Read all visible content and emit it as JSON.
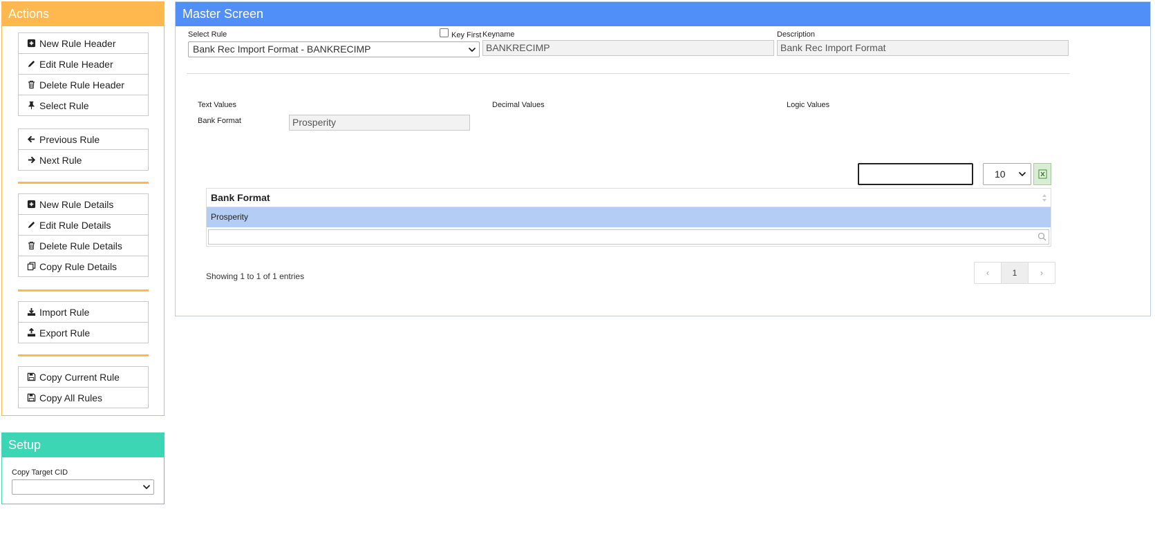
{
  "actions": {
    "title": "Actions",
    "groups": [
      [
        {
          "label": "New Rule Header",
          "icon": "plus-square-icon"
        },
        {
          "label": "Edit Rule Header",
          "icon": "pencil-icon"
        },
        {
          "label": "Delete Rule Header",
          "icon": "trash-icon"
        },
        {
          "label": "Select Rule",
          "icon": "pushpin-icon"
        }
      ],
      [
        {
          "label": "Previous Rule",
          "icon": "arrow-left-icon"
        },
        {
          "label": "Next Rule",
          "icon": "arrow-right-icon"
        }
      ],
      [
        {
          "label": "New Rule Details",
          "icon": "plus-square-icon"
        },
        {
          "label": "Edit Rule Details",
          "icon": "pencil-icon"
        },
        {
          "label": "Delete Rule Details",
          "icon": "trash-icon"
        },
        {
          "label": "Copy Rule Details",
          "icon": "copy-icon"
        }
      ],
      [
        {
          "label": "Import Rule",
          "icon": "download-icon"
        },
        {
          "label": "Export Rule",
          "icon": "upload-icon"
        }
      ],
      [
        {
          "label": "Copy Current Rule",
          "icon": "floppy-disk-icon"
        },
        {
          "label": "Copy All Rules",
          "icon": "floppy-disk-icon"
        }
      ]
    ]
  },
  "setup": {
    "title": "Setup",
    "copy_target_label": "Copy Target CID",
    "copy_target_value": ""
  },
  "master": {
    "title": "Master Screen",
    "select_rule_label": "Select Rule",
    "select_rule_value": "Bank Rec Import Format - BANKRECIMP",
    "key_first_label": "Key First",
    "keyname_label": "Keyname",
    "keyname_value": "BANKRECIMP",
    "description_label": "Description",
    "description_value": "Bank Rec Import Format",
    "text_values_label": "Text Values",
    "decimal_values_label": "Decimal Values",
    "logic_values_label": "Logic Values",
    "bank_format_label": "Bank Format",
    "bank_format_value": "Prosperity"
  },
  "table": {
    "page_length": "10",
    "columns": [
      "Bank Format"
    ],
    "rows": [
      [
        "Prosperity"
      ]
    ],
    "info": "Showing 1 to 1 of 1 entries",
    "pager": {
      "prev": "‹",
      "current": "1",
      "next": "›"
    }
  },
  "colors": {
    "actions_header": "#ffb84d",
    "setup_header": "#3dd6b5",
    "master_header": "#4f8ff7",
    "selected_row": "#b3cdf5"
  }
}
